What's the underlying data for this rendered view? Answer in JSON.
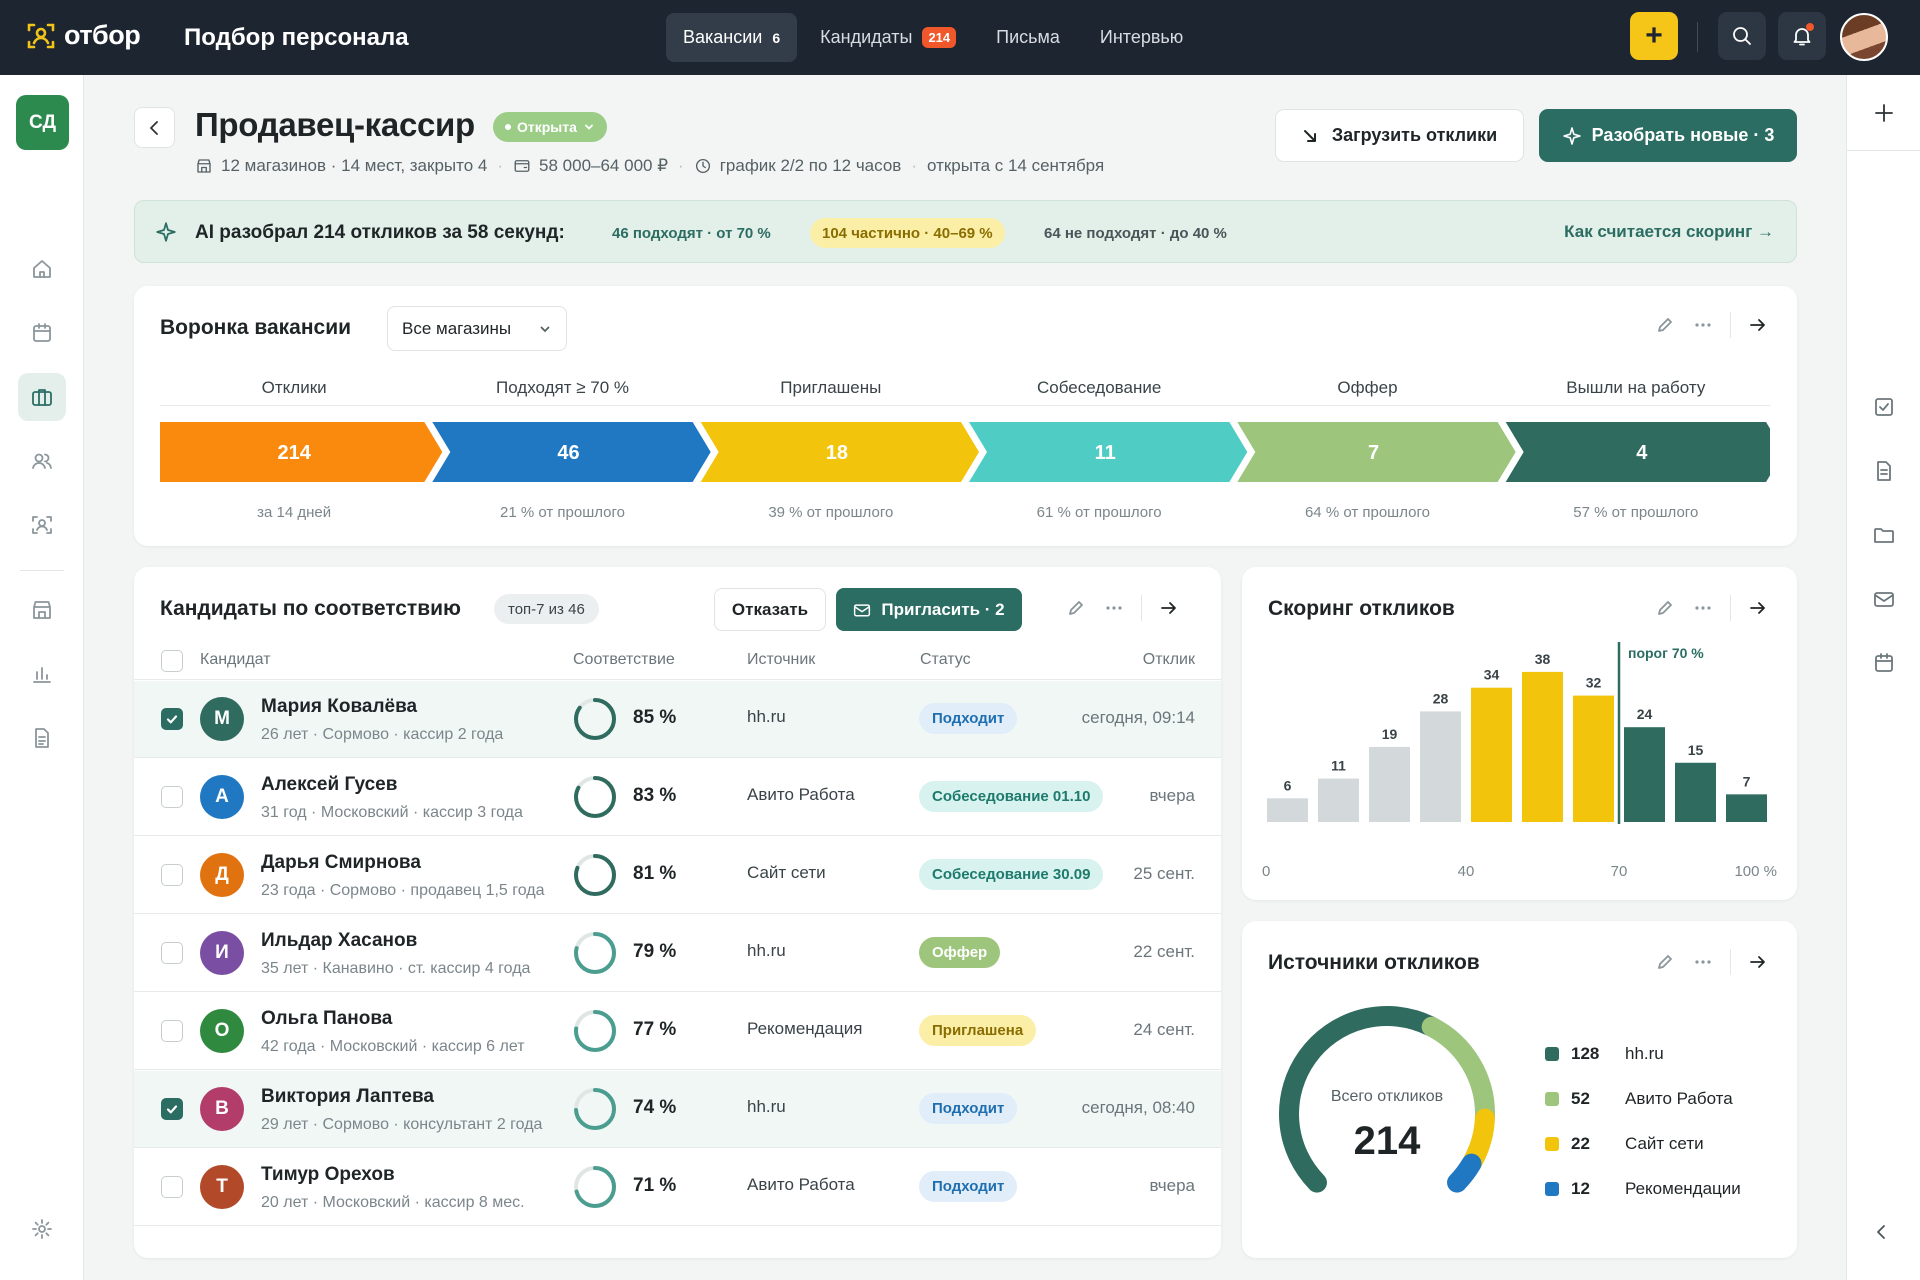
{
  "topbar": {
    "logo_text": "отбор",
    "app_title": "Подбор персонала",
    "nav": [
      {
        "label": "Вакансии",
        "count": "6",
        "active": true
      },
      {
        "label": "Кандидаты",
        "badge": "214"
      },
      {
        "label": "Письма"
      },
      {
        "label": "Интервью"
      }
    ],
    "add_label": "+"
  },
  "sidebar": {
    "org_initials": "СД"
  },
  "vacancy": {
    "title": "Продавец-кассир",
    "status": "Открыта",
    "meta": {
      "stores": "12 магазинов · 14 мест, закрыто 4",
      "salary": "58 000–64 000 ₽",
      "schedule": "график 2/2 по 12 часов",
      "opened": "открыта с 14 сентября"
    },
    "upload_label": "Загрузить отклики",
    "parse_label": "Разобрать новые · 3"
  },
  "ai_banner": {
    "summary": "AI разобрал 214 откликов за 58 секунд:",
    "fit": "46 подходят · от 70 %",
    "partial": "104 частично · 40–69 %",
    "nofit": "64 не подходят · до 40 %",
    "link": "Как считается скоринг →"
  },
  "funnel": {
    "title": "Воронка вакансии",
    "store_filter": "Все магазины",
    "stages": [
      {
        "label": "Отклики",
        "value": "214",
        "sub": "за 14 дней",
        "color": "#f98a0e"
      },
      {
        "label": "Подходят ≥ 70 %",
        "value": "46",
        "sub": "21 % от прошлого",
        "color": "#1f78c1"
      },
      {
        "label": "Приглашены",
        "value": "18",
        "sub": "39 % от прошлого",
        "color": "#f2c40c"
      },
      {
        "label": "Собеседование",
        "value": "11",
        "sub": "61 % от прошлого",
        "color": "#4fcdc4"
      },
      {
        "label": "Оффер",
        "value": "7",
        "sub": "64 % от прошлого",
        "color": "#9ec57c"
      },
      {
        "label": "Вышли на работу",
        "value": "4",
        "sub": "57 % от прошлого",
        "color": "#2f6b5e"
      }
    ]
  },
  "candidates": {
    "title": "Кандидаты по соответствию",
    "top_badge": "топ-7 из 46",
    "reject_label": "Отказать",
    "invite_label": "Пригласить · 2",
    "columns": {
      "candidate": "Кандидат",
      "match": "Соответствие",
      "source": "Источник",
      "status": "Статус",
      "response": "Отклик"
    },
    "rows": [
      {
        "initial": "М",
        "name": "Мария Ковалёва",
        "sub": "26 лет · Сормово · кассир 2 года",
        "match": "85 %",
        "match_value": 85,
        "source": "hh.ru",
        "status": "Подходит",
        "status_type": "fit",
        "when": "сегодня, 09:14",
        "checked": true,
        "avatar_color": "#2f6b5e"
      },
      {
        "initial": "А",
        "name": "Алексей Гусев",
        "sub": "31 год · Московский · кассир 3 года",
        "match": "83 %",
        "match_value": 83,
        "source": "Авито Работа",
        "status": "Собеседование 01.10",
        "status_type": "interview",
        "when": "вчера",
        "checked": false,
        "avatar_color": "#1f78c1"
      },
      {
        "initial": "Д",
        "name": "Дарья Смирнова",
        "sub": "23 года · Сормово · продавец 1,5 года",
        "match": "81 %",
        "match_value": 81,
        "source": "Сайт сети",
        "status": "Собеседование 30.09",
        "status_type": "interview",
        "when": "25 сент.",
        "checked": false,
        "avatar_color": "#e0720f"
      },
      {
        "initial": "И",
        "name": "Ильдар Хасанов",
        "sub": "35 лет · Канавино · ст. кассир 4 года",
        "match": "79 %",
        "match_value": 79,
        "source": "hh.ru",
        "status": "Оффер",
        "status_type": "offer",
        "when": "22 сент.",
        "checked": false,
        "avatar_color": "#7a4fa3"
      },
      {
        "initial": "О",
        "name": "Ольга Панова",
        "sub": "42 года · Московский · кассир 6 лет",
        "match": "77 %",
        "match_value": 77,
        "source": "Рекомендация",
        "status": "Приглашена",
        "status_type": "invited",
        "when": "24 сент.",
        "checked": false,
        "avatar_color": "#2f8a3f"
      },
      {
        "initial": "В",
        "name": "Виктория Лаптева",
        "sub": "29 лет · Сормово · консультант 2 года",
        "match": "74 %",
        "match_value": 74,
        "source": "hh.ru",
        "status": "Подходит",
        "status_type": "fit",
        "when": "сегодня, 08:40",
        "checked": true,
        "avatar_color": "#b23d6b"
      },
      {
        "initial": "Т",
        "name": "Тимур Орехов",
        "sub": "20 лет · Московский · кассир 8 мес.",
        "match": "71 %",
        "match_value": 71,
        "source": "Авито Работа",
        "status": "Подходит",
        "status_type": "fit",
        "when": "вчера",
        "checked": false,
        "avatar_color": "#b24a2a"
      }
    ]
  },
  "scoring": {
    "title": "Скоринг откликов",
    "threshold_label": "порог 70 %"
  },
  "chart_data": [
    {
      "type": "bar",
      "title": "Скоринг откликов",
      "categories": [
        "0–10",
        "10–20",
        "20–30",
        "30–40",
        "40–50",
        "50–60",
        "60–70",
        "70–80",
        "80–90",
        "90–100"
      ],
      "values": [
        6,
        11,
        19,
        28,
        34,
        38,
        32,
        24,
        15,
        7
      ],
      "colors": [
        "#d3d8db",
        "#d3d8db",
        "#d3d8db",
        "#d3d8db",
        "#f2c40c",
        "#f2c40c",
        "#f2c40c",
        "#2f6b5e",
        "#2f6b5e",
        "#2f6b5e"
      ],
      "xlim": [
        0,
        100
      ],
      "x_ticks": [
        "0",
        "40",
        "70",
        "100 %"
      ],
      "threshold": 70,
      "threshold_label": "порог 70 %",
      "ylim": [
        0,
        40
      ],
      "grid": false
    },
    {
      "type": "pie",
      "title": "Источники откликов",
      "center_caption": "Всего откликов",
      "total": "214",
      "slices": [
        {
          "label": "hh.ru",
          "value": 128,
          "color": "#2f6b5e"
        },
        {
          "label": "Авито Работа",
          "value": 52,
          "color": "#9ec57c"
        },
        {
          "label": "Сайт сети",
          "value": 22,
          "color": "#f2c40c"
        },
        {
          "label": "Рекомендации",
          "value": 12,
          "color": "#1f78c1"
        }
      ]
    }
  ],
  "sources": {
    "title": "Источники откликов",
    "center_caption": "Всего откликов",
    "total": "214"
  }
}
